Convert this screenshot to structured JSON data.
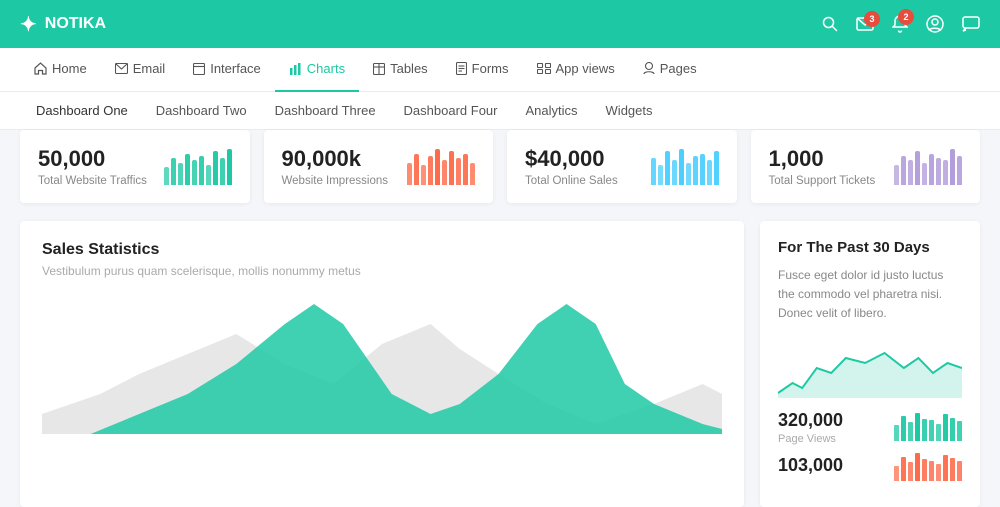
{
  "header": {
    "logo_text": "NOTIKA",
    "logo_icon": "✦",
    "actions": [
      {
        "name": "search-icon",
        "icon": "🔍",
        "badge": null
      },
      {
        "name": "mail-icon",
        "icon": "✉",
        "badge": "3"
      },
      {
        "name": "bell-icon",
        "icon": "🔔",
        "badge": "2"
      },
      {
        "name": "user-icon",
        "icon": "😊",
        "badge": null
      },
      {
        "name": "chat-icon",
        "icon": "💬",
        "badge": null
      }
    ]
  },
  "nav_primary": {
    "items": [
      {
        "label": "Home",
        "icon": "⊞",
        "active": false
      },
      {
        "label": "Email",
        "icon": "✉",
        "active": false
      },
      {
        "label": "Interface",
        "icon": "▣",
        "active": false
      },
      {
        "label": "Charts",
        "icon": "📊",
        "active": true
      },
      {
        "label": "Tables",
        "icon": "⬜",
        "active": false
      },
      {
        "label": "Forms",
        "icon": "📋",
        "active": false
      },
      {
        "label": "App views",
        "icon": "⚙",
        "active": false
      },
      {
        "label": "Pages",
        "icon": "👤",
        "active": false
      }
    ]
  },
  "nav_secondary": {
    "items": [
      {
        "label": "Dashboard One",
        "active": true
      },
      {
        "label": "Dashboard Two",
        "active": false
      },
      {
        "label": "Dashboard Three",
        "active": false
      },
      {
        "label": "Dashboard Four",
        "active": false
      },
      {
        "label": "Analytics",
        "active": false
      },
      {
        "label": "Widgets",
        "active": false
      }
    ]
  },
  "stats": [
    {
      "value": "50,000",
      "label": "Total Website Traffics",
      "color": "#1dc9a4",
      "bars": [
        30,
        50,
        40,
        60,
        45,
        55,
        35,
        65,
        50,
        70
      ]
    },
    {
      "value": "90,000k",
      "label": "Website Impressions",
      "color": "#ff6b4a",
      "bars": [
        40,
        60,
        35,
        55,
        70,
        45,
        65,
        50,
        60,
        40
      ]
    },
    {
      "value": "$40,000",
      "label": "Total Online Sales",
      "color": "#4acfff",
      "bars": [
        50,
        35,
        65,
        45,
        70,
        40,
        55,
        60,
        45,
        65
      ]
    },
    {
      "value": "1,000",
      "label": "Total Support Tickets",
      "color": "#b39ddb",
      "bars": [
        35,
        55,
        45,
        65,
        40,
        60,
        50,
        45,
        70,
        55
      ]
    }
  ],
  "sales_stats": {
    "title": "Sales Statistics",
    "subtitle": "Vestibulum purus quam scelerisque, mollis nonummy metus"
  },
  "right_panel": {
    "title": "For The Past 30 Days",
    "text": "Fusce eget dolor id justo luctus the commodo vel pharetra nisi. Donec velit of libero.",
    "stats": [
      {
        "value": "320,000",
        "label": "Page Views",
        "color": "#1dc9a4",
        "bars": [
          20,
          35,
          25,
          40,
          30,
          28,
          22,
          38,
          32,
          27
        ]
      },
      {
        "value": "103,000",
        "label": "",
        "color": "#ff6b4a",
        "bars": [
          15,
          28,
          20,
          33,
          25,
          22,
          18,
          30,
          26,
          22
        ]
      }
    ]
  }
}
